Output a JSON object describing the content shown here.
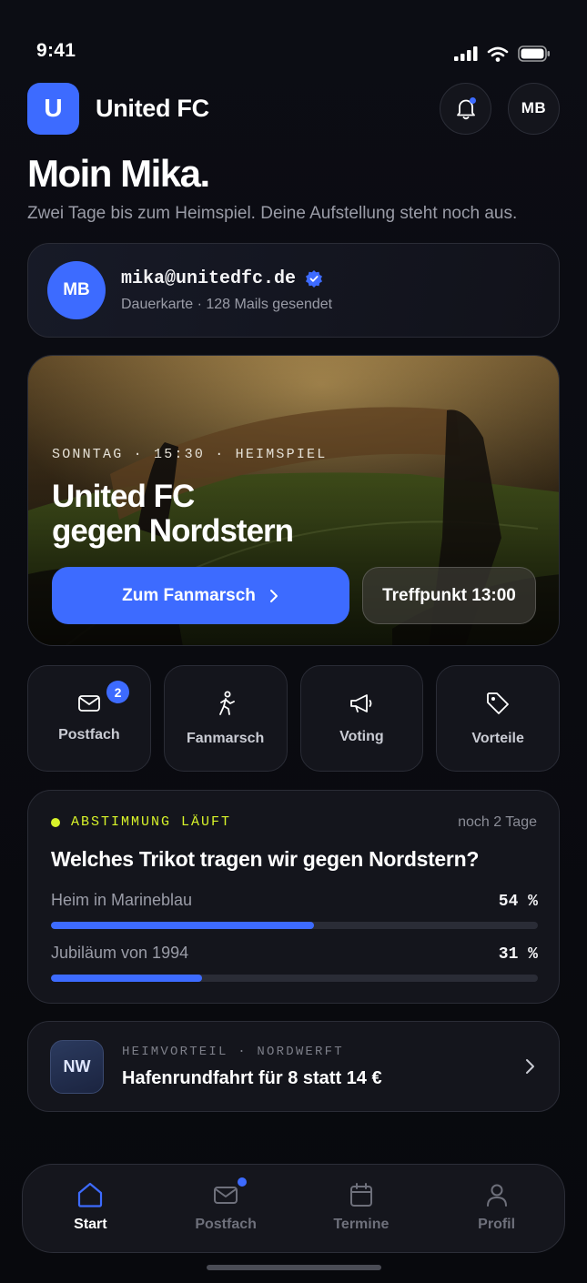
{
  "status_bar": {
    "time": "9:41"
  },
  "header": {
    "logo_letter": "U",
    "title": "United FC",
    "avatar_initials": "MB"
  },
  "greeting": {
    "title": "Moin Mika.",
    "subtitle": "Zwei Tage bis zum Heimspiel. Deine Aufstellung steht noch aus."
  },
  "account": {
    "avatar_initials": "MB",
    "email": "mika@unitedfc.de",
    "meta": "Dauerkarte · 128 Mails gesendet",
    "verified": true
  },
  "hero": {
    "kicker": "SONNTAG · 15:30 · HEIMSPIEL",
    "title_line1": "United FC",
    "title_line2": "gegen Nordstern",
    "primary_button": "Zum Fanmarsch",
    "secondary_button": "Treffpunkt 13:00"
  },
  "quick_actions": [
    {
      "label": "Postfach",
      "icon": "mail-icon",
      "badge": "2"
    },
    {
      "label": "Fanmarsch",
      "icon": "walking-person-icon"
    },
    {
      "label": "Voting",
      "icon": "megaphone-icon"
    },
    {
      "label": "Vorteile",
      "icon": "tag-icon"
    }
  ],
  "poll": {
    "status": "ABSTIMMUNG LÄUFT",
    "deadline": "noch 2 Tage",
    "question": "Welches Trikot tragen wir gegen Nordstern?",
    "options": [
      {
        "label": "Heim in Marineblau",
        "pct_label": "54 %",
        "value": 0.54
      },
      {
        "label": "Jubiläum von 1994",
        "pct_label": "31 %",
        "value": 0.31
      }
    ]
  },
  "offer": {
    "logo": "NW",
    "kicker": "HEIMVORTEIL · NORDWERFT",
    "title": "Hafenrundfahrt für 8 statt 14 €"
  },
  "bottom_nav": [
    {
      "label": "Start",
      "icon": "home-icon",
      "active": true
    },
    {
      "label": "Postfach",
      "icon": "mail-icon",
      "dot": true
    },
    {
      "label": "Termine",
      "icon": "calendar-icon"
    },
    {
      "label": "Profil",
      "icon": "user-icon"
    }
  ],
  "colors": {
    "accent": "#3d6bff",
    "live": "#d8f32a",
    "background": "#0b0c12",
    "card": "#14151c"
  }
}
